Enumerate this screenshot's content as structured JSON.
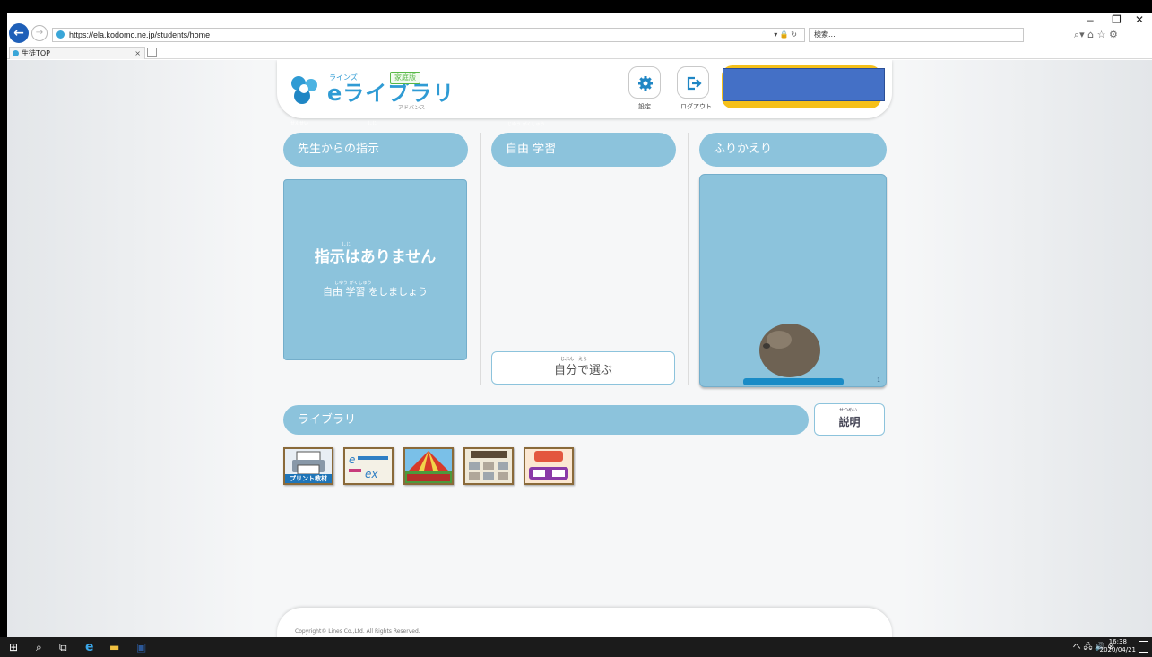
{
  "browser": {
    "url": "https://ela.kodomo.ne.jp/students/home",
    "url_right_icons": "▾ 🔒 ↻",
    "search_placeholder": "検索...",
    "tab_title": "生徒TOP",
    "tab_close": "×",
    "window_controls": {
      "minimize": "–",
      "restore": "❐",
      "close": "✕"
    },
    "toolbar_icons": "⌕▾  ⌂ ☆ ⚙"
  },
  "header": {
    "logo_small": "ラインズ",
    "logo_text": "eライブラリ",
    "logo_edition": "家庭版",
    "logo_sub": "アドバンス",
    "settings_label": "設定",
    "logout_label": "ログアウト",
    "accent_color": "#f5c01a",
    "mask_color": "#4470c6"
  },
  "columns": {
    "instructions": {
      "title": "先生からの指示",
      "ruby_1": "せんせい",
      "ruby_2": "しじ"
    },
    "free_study": {
      "title": "自由 学習",
      "ruby": "じゆう がくしゅう"
    },
    "review": {
      "title": "ふりかえり",
      "page_num": "1"
    }
  },
  "notice": {
    "main": "指示はありません",
    "main_ruby": "しじ",
    "sub": "自由 学習 をしましょう",
    "sub_ruby": "じゆう がくしゅう"
  },
  "choose_button": {
    "label": "自分で選ぶ",
    "ruby": "じぶん　えら"
  },
  "library": {
    "title": "ライブラリ",
    "explain_button": "説明",
    "explain_ruby": "せつめい",
    "icons": [
      {
        "name": "print-materials",
        "label": "プリント教材"
      },
      {
        "name": "e-library-handwriting",
        "label": "手書き"
      },
      {
        "name": "supermarket-town",
        "label": "スーパーマーケットタウン"
      },
      {
        "name": "english-conversation",
        "label": "英会話教材"
      },
      {
        "name": "iroiro-card",
        "label": "カード"
      }
    ]
  },
  "footer": {
    "copyright": "Copyright© Lines Co.,Ltd. All Rights Reserved."
  },
  "taskbar": {
    "time": "16:38",
    "date": "2020/04/21",
    "tray": "へ 🖧 🔊 ⊗"
  },
  "colors": {
    "panel_blue": "#8cc3dc",
    "ie_blue": "#1e5fb8",
    "taskbar": "#1b1b1b"
  }
}
